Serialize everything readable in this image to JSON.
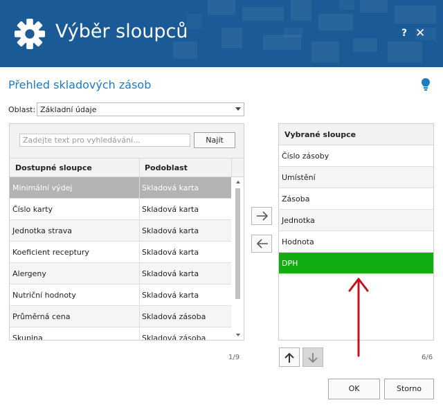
{
  "window": {
    "title": "Výběr sloupců",
    "help_label": "?",
    "close_label": "✕",
    "colors": {
      "header_bg": "#1a5a96",
      "accent": "#1d7bc0",
      "selected_green": "#10ac10"
    }
  },
  "subtitle": "Přehled skladových zásob",
  "area": {
    "label": "Oblast:",
    "value": "Základní údaje"
  },
  "search": {
    "placeholder": "Zadejte text pro vyhledávání...",
    "button_label": "Najít"
  },
  "available": {
    "headers": [
      "Dostupné sloupce",
      "Podoblast"
    ],
    "rows": [
      {
        "name": "Minimální výdej",
        "sub": "Skladová karta"
      },
      {
        "name": "Číslo karty",
        "sub": "Skladová karta"
      },
      {
        "name": "Jednotka strava",
        "sub": "Skladová karta"
      },
      {
        "name": "Koeficient receptury",
        "sub": "Skladová karta"
      },
      {
        "name": "Alergeny",
        "sub": "Skladová karta"
      },
      {
        "name": "Nutriční hodnoty",
        "sub": "Skladová karta"
      },
      {
        "name": "Průměrná cena",
        "sub": "Skladová zásoba"
      },
      {
        "name": "Skupina",
        "sub": "Skladová zásoba"
      }
    ],
    "pager": "1/9"
  },
  "selected": {
    "header": "Vybrané sloupce",
    "rows": [
      "Číslo zásoby",
      "Umístění",
      "Zásoba",
      "Jednotka",
      "Hodnota",
      "DPH"
    ],
    "pager": "6/6"
  },
  "footer": {
    "ok_label": "OK",
    "cancel_label": "Storno"
  },
  "icons": {
    "gear": "gear-icon",
    "help": "help-icon",
    "close": "close-icon",
    "bulb": "lightbulb-icon",
    "right": "arrow-right-icon",
    "left": "arrow-left-icon",
    "up": "arrow-up-icon",
    "down": "arrow-down-icon"
  }
}
